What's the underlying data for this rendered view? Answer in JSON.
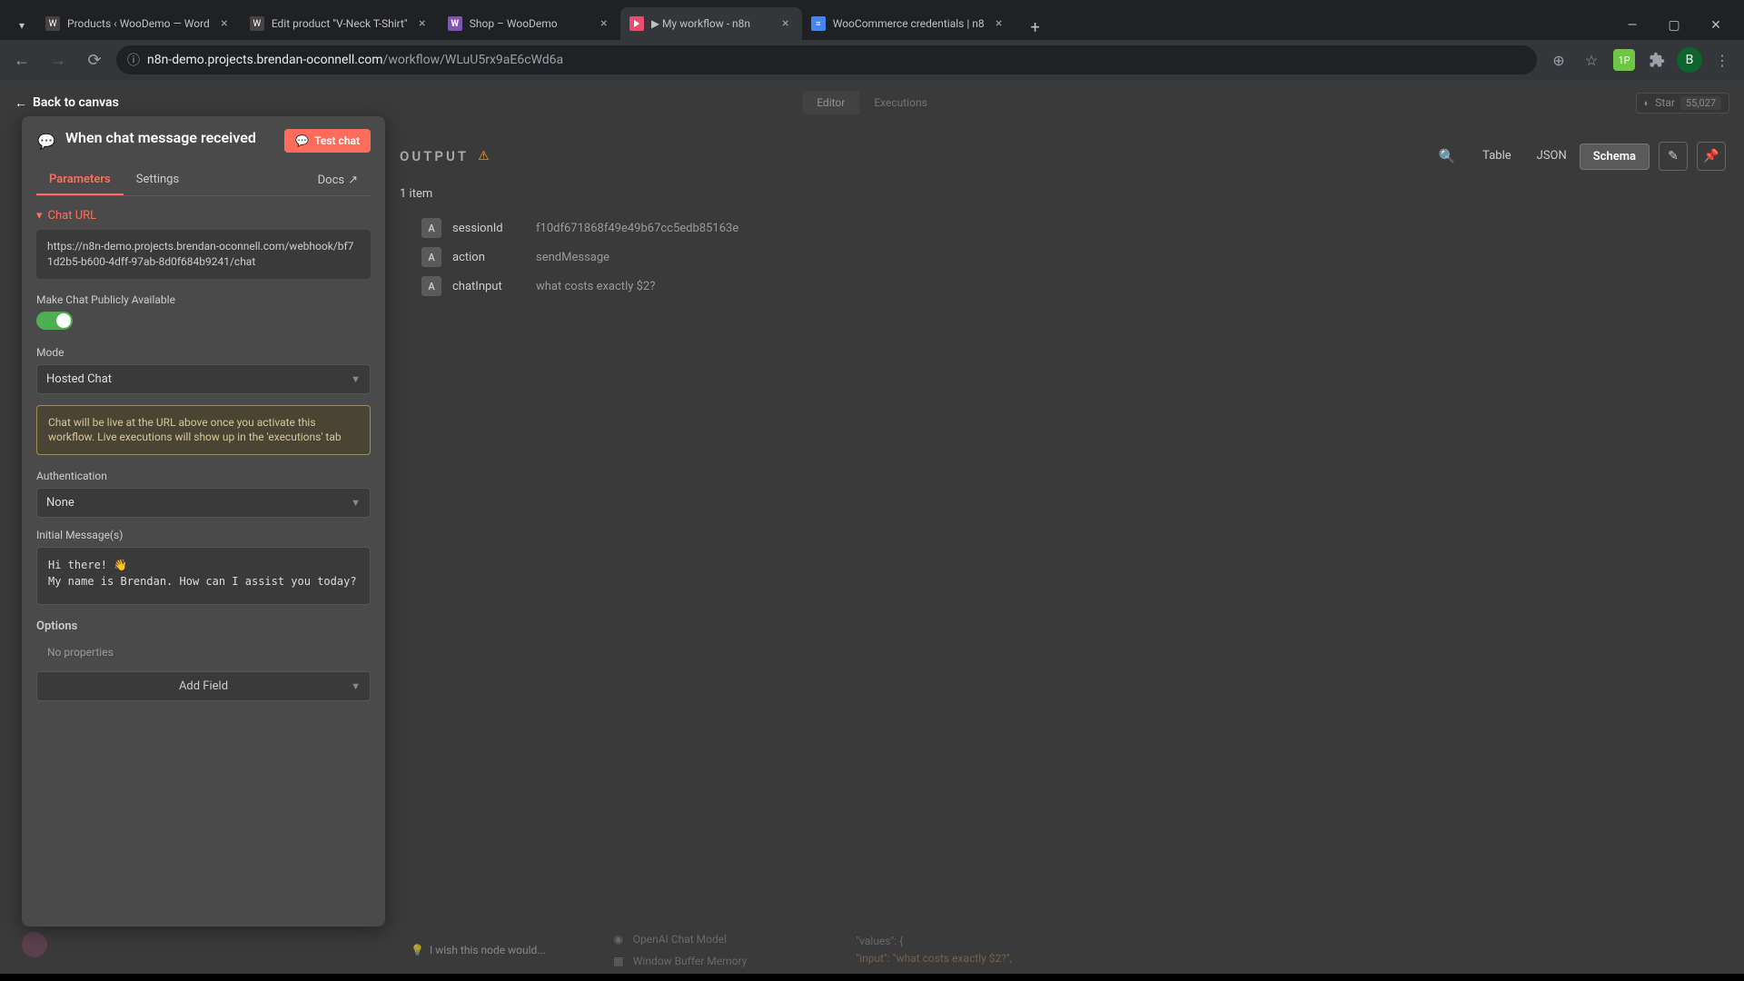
{
  "browser": {
    "tabs": [
      {
        "title": "Products ‹ WooDemo — Word",
        "fav": "wp"
      },
      {
        "title": "Edit product \"V-Neck T-Shirt\"",
        "fav": "wp"
      },
      {
        "title": "Shop – WooDemo",
        "fav": "woo"
      },
      {
        "title": "▶ My workflow - n8n",
        "fav": "n8n",
        "active": true
      },
      {
        "title": "WooCommerce credentials | n8",
        "fav": "doc"
      }
    ],
    "url_prefix": "n8n-demo.projects.brendan-oconnell.com",
    "url_path": "/workflow/WLuU5rx9aE6cWd6a",
    "avatar": "B"
  },
  "topbar": {
    "back": "Back to canvas",
    "editor": "Editor",
    "executions": "Executions",
    "gh_star": "Star",
    "gh_count": "55,027"
  },
  "panel": {
    "title": "When chat message received",
    "test_btn": "Test chat",
    "tab_params": "Parameters",
    "tab_settings": "Settings",
    "docs": "Docs",
    "chat_url_label": "Chat URL",
    "chat_url": "https://n8n-demo.projects.brendan-oconnell.com/webhook/bf71d2b5-b600-4dff-97ab-8d0f684b9241/chat",
    "public_label": "Make Chat Publicly Available",
    "mode_label": "Mode",
    "mode_value": "Hosted Chat",
    "info": "Chat will be live at the URL above once you activate this workflow. Live executions will show up in the 'executions' tab",
    "auth_label": "Authentication",
    "auth_value": "None",
    "init_label": "Initial Message(s)",
    "init_value": "Hi there! 👋\nMy name is Brendan. How can I assist you today?",
    "options_label": "Options",
    "no_props": "No properties",
    "add_field": "Add Field"
  },
  "output": {
    "title": "OUTPUT",
    "count": "1 item",
    "view_table": "Table",
    "view_json": "JSON",
    "view_schema": "Schema",
    "rows": [
      {
        "type": "A",
        "key": "sessionId",
        "val": "f10df671868f49e49b67cc5edb85163e"
      },
      {
        "type": "A",
        "key": "action",
        "val": "sendMessage"
      },
      {
        "type": "A",
        "key": "chatInput",
        "val": "what costs exactly $2?"
      }
    ]
  },
  "bottom": {
    "wish": "I wish this node would...",
    "nodes": [
      "OpenAI Chat Model",
      "Window Buffer Memory"
    ],
    "code_l1": "\"values\": {",
    "code_l2": "  \"input\": \"what costs exactly $2?\","
  }
}
